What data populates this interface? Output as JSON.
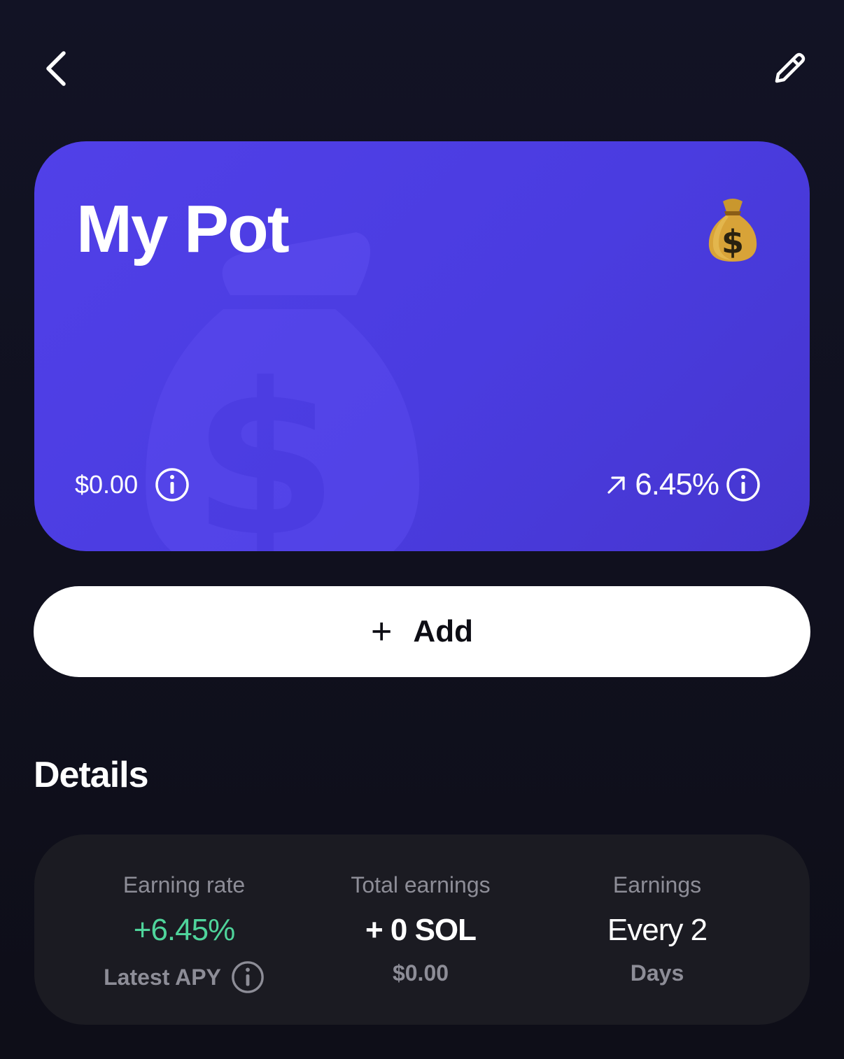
{
  "header": {
    "back_icon": "chevron-left-icon",
    "edit_icon": "pencil-icon"
  },
  "card": {
    "title": "My Pot",
    "emoji": "money-bag-icon",
    "balance": "$0.00",
    "rate": "6.45%",
    "rate_icon": "arrow-up-right-icon",
    "background_color": "#4f3ee6"
  },
  "add_button": {
    "plus": "+",
    "label": "Add"
  },
  "details": {
    "heading": "Details",
    "earning_rate": {
      "label": "Earning rate",
      "value": "+6.45%",
      "sub": "Latest APY",
      "value_color": "#4fd49b"
    },
    "total_earnings": {
      "label": "Total earnings",
      "value": "+ 0 SOL",
      "sub": "$0.00"
    },
    "earnings_frequency": {
      "label": "Earnings",
      "value": "Every 2",
      "sub": "Days"
    }
  }
}
